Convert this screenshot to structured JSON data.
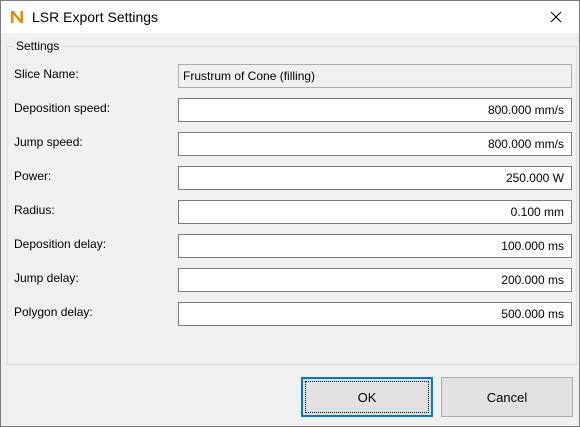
{
  "window": {
    "title": "LSR Export Settings"
  },
  "icons": {
    "app": "app-logo-icon",
    "close": "close-icon"
  },
  "settings": {
    "legend": "Settings",
    "fields": [
      {
        "label": "Slice Name:",
        "value": "Frustrum of Cone (filling)",
        "readonly": true
      },
      {
        "label": "Deposition speed:",
        "value": "800.000 mm/s"
      },
      {
        "label": "Jump speed:",
        "value": "800.000 mm/s"
      },
      {
        "label": "Power:",
        "value": "250.000 W"
      },
      {
        "label": "Radius:",
        "value": "0.100 mm"
      },
      {
        "label": "Deposition delay:",
        "value": "100.000 ms"
      },
      {
        "label": "Jump delay:",
        "value": "200.000 ms"
      },
      {
        "label": "Polygon delay:",
        "value": "500.000 ms"
      }
    ]
  },
  "buttons": {
    "ok": "OK",
    "cancel": "Cancel"
  },
  "colors": {
    "accent": "#0078d7",
    "logo": "#f08c00"
  }
}
